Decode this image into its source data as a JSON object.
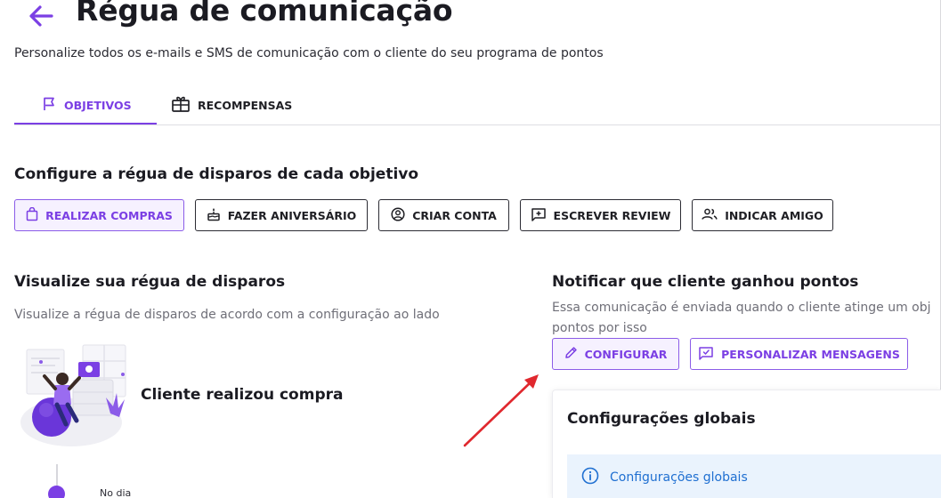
{
  "header": {
    "title": "Régua de comunicação",
    "subtitle": "Personalize todos os e-mails e SMS de comunicação com o cliente do seu programa de pontos"
  },
  "tabs": [
    {
      "label": "OBJETIVOS",
      "icon": "flag-icon",
      "active": true
    },
    {
      "label": "RECOMPENSAS",
      "icon": "gift-icon",
      "active": false
    }
  ],
  "objectives": {
    "heading": "Configure a régua de disparos de cada objetivo",
    "buttons": [
      {
        "label": "REALIZAR COMPRAS",
        "icon": "shopping-bag-icon",
        "selected": true
      },
      {
        "label": "FAZER ANIVERSÁRIO",
        "icon": "cake-icon",
        "selected": false
      },
      {
        "label": "CRIAR CONTA",
        "icon": "account-circle-icon",
        "selected": false
      },
      {
        "label": "ESCREVER REVIEW",
        "icon": "review-icon",
        "selected": false
      },
      {
        "label": "INDICAR AMIGO",
        "icon": "people-icon",
        "selected": false
      }
    ]
  },
  "visualize": {
    "heading": "Visualize sua régua de disparos",
    "description": "Visualize a régua de disparos de acordo com a configuração ao lado",
    "event_label": "Cliente realizou compra",
    "timeline_text": "No dia"
  },
  "notify": {
    "heading": "Notificar que cliente ganhou pontos",
    "description_line1": "Essa comunicação é enviada quando o cliente atinge um obj",
    "description_line2": "pontos por isso",
    "configure_label": "CONFIGURAR",
    "customize_label": "PERSONALIZAR MENSAGENS"
  },
  "global_settings": {
    "card_title": "Configurações globais",
    "info_text": "Configurações globais"
  },
  "colors": {
    "accent": "#7b3fe4",
    "accent_bg": "#f6f1ff",
    "info_bg": "#eaf3fd",
    "info_text": "#1f6fd1",
    "annotation_arrow": "#e0282e"
  }
}
